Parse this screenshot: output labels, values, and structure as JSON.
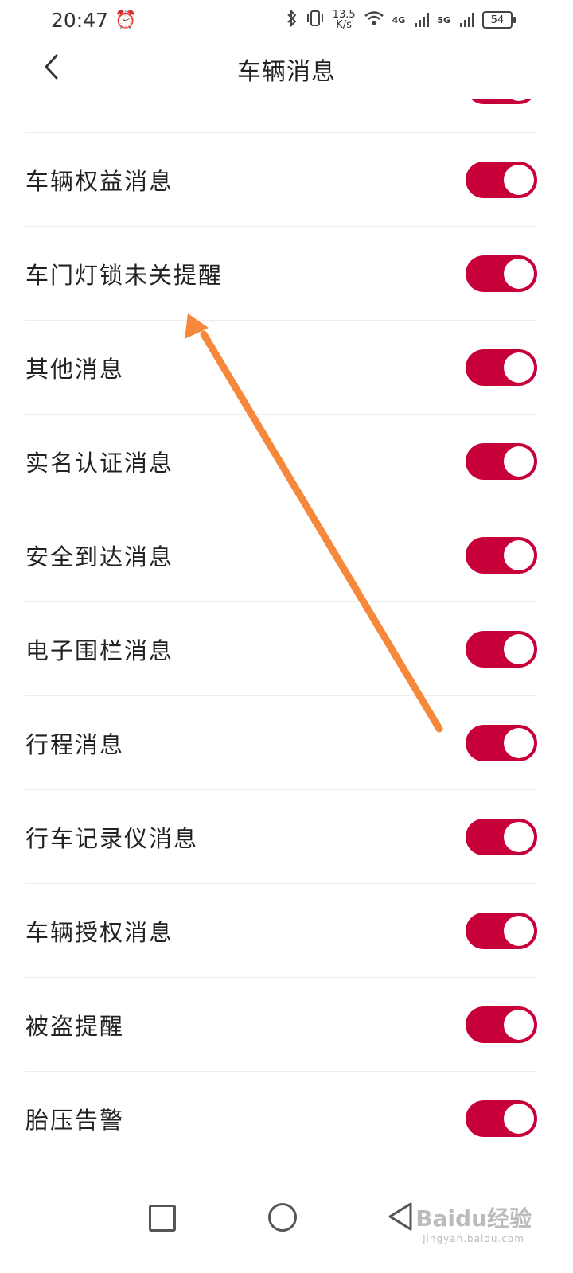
{
  "status_bar": {
    "time": "20:47",
    "net_speed_value": "13.5",
    "net_speed_unit": "K/s",
    "signal_1_label": "4G",
    "signal_2_label": "5G",
    "battery_level": "54"
  },
  "header": {
    "title": "车辆消息"
  },
  "list": {
    "items": [
      {
        "label": "",
        "enabled": true
      },
      {
        "label": "车辆权益消息",
        "enabled": true
      },
      {
        "label": "车门灯锁未关提醒",
        "enabled": true
      },
      {
        "label": "其他消息",
        "enabled": true
      },
      {
        "label": "实名认证消息",
        "enabled": true
      },
      {
        "label": "安全到达消息",
        "enabled": true
      },
      {
        "label": "电子围栏消息",
        "enabled": true
      },
      {
        "label": "行程消息",
        "enabled": true
      },
      {
        "label": "行车记录仪消息",
        "enabled": true
      },
      {
        "label": "车辆授权消息",
        "enabled": true
      },
      {
        "label": "被盗提醒",
        "enabled": true
      },
      {
        "label": "胎压告警",
        "enabled": true
      }
    ]
  },
  "watermark": {
    "brand": "Baidu经验",
    "url": "jingyan.baidu.com"
  },
  "colors": {
    "toggle_on": "#c8003a",
    "annotation_arrow": "#f5883a"
  },
  "icons": {
    "back": "chevron-left-icon",
    "alarm": "alarm-clock-icon",
    "bluetooth": "bluetooth-icon",
    "vibrate": "vibrate-icon",
    "wifi": "wifi-icon",
    "battery": "battery-icon"
  }
}
